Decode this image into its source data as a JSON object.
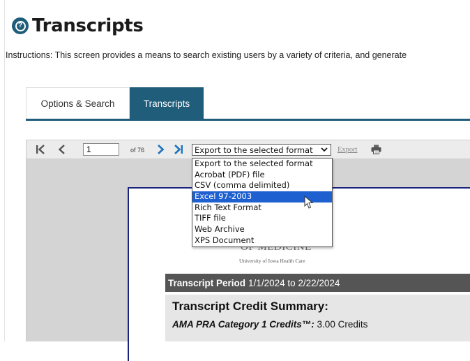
{
  "header": {
    "title": "Transcripts",
    "help_icon": "help-circle-icon",
    "instructions": "Instructions: This screen provides a means to search existing users by a variety of criteria, and generate"
  },
  "tabs": [
    {
      "label": "Options & Search",
      "active": false
    },
    {
      "label": "Transcripts",
      "active": true
    }
  ],
  "toolbar": {
    "page_value": "1",
    "of_label": "of 76",
    "format_selected": "Export to the selected format",
    "export_label": "Export",
    "icons": [
      "first-page-icon",
      "prev-page-icon",
      "next-page-icon",
      "last-page-icon",
      "print-icon"
    ]
  },
  "dropdown": {
    "options": [
      "Export to the selected format",
      "Acrobat (PDF) file",
      "CSV (comma delimited)",
      "Excel 97-2003",
      "Rich Text Format",
      "TIFF file",
      "Web Archive",
      "XPS Document"
    ],
    "highlighted": "Excel 97-2003"
  },
  "report": {
    "logo_line": "OF MEDICINE",
    "logo_subline": "University of Iowa Health Care",
    "period_label": "Transcript Period",
    "period_value": "1/1/2024 to 2/22/2024",
    "summary_title": "Transcript Credit Summary:",
    "credit_label": "AMA PRA Category 1 Credits™:",
    "credit_value": "3.00 Credits"
  },
  "colors": {
    "accent": "#1f5d7a",
    "toolbar_arrows": "#1e73be",
    "selection": "#1e60d0",
    "period_bar": "#555555"
  }
}
